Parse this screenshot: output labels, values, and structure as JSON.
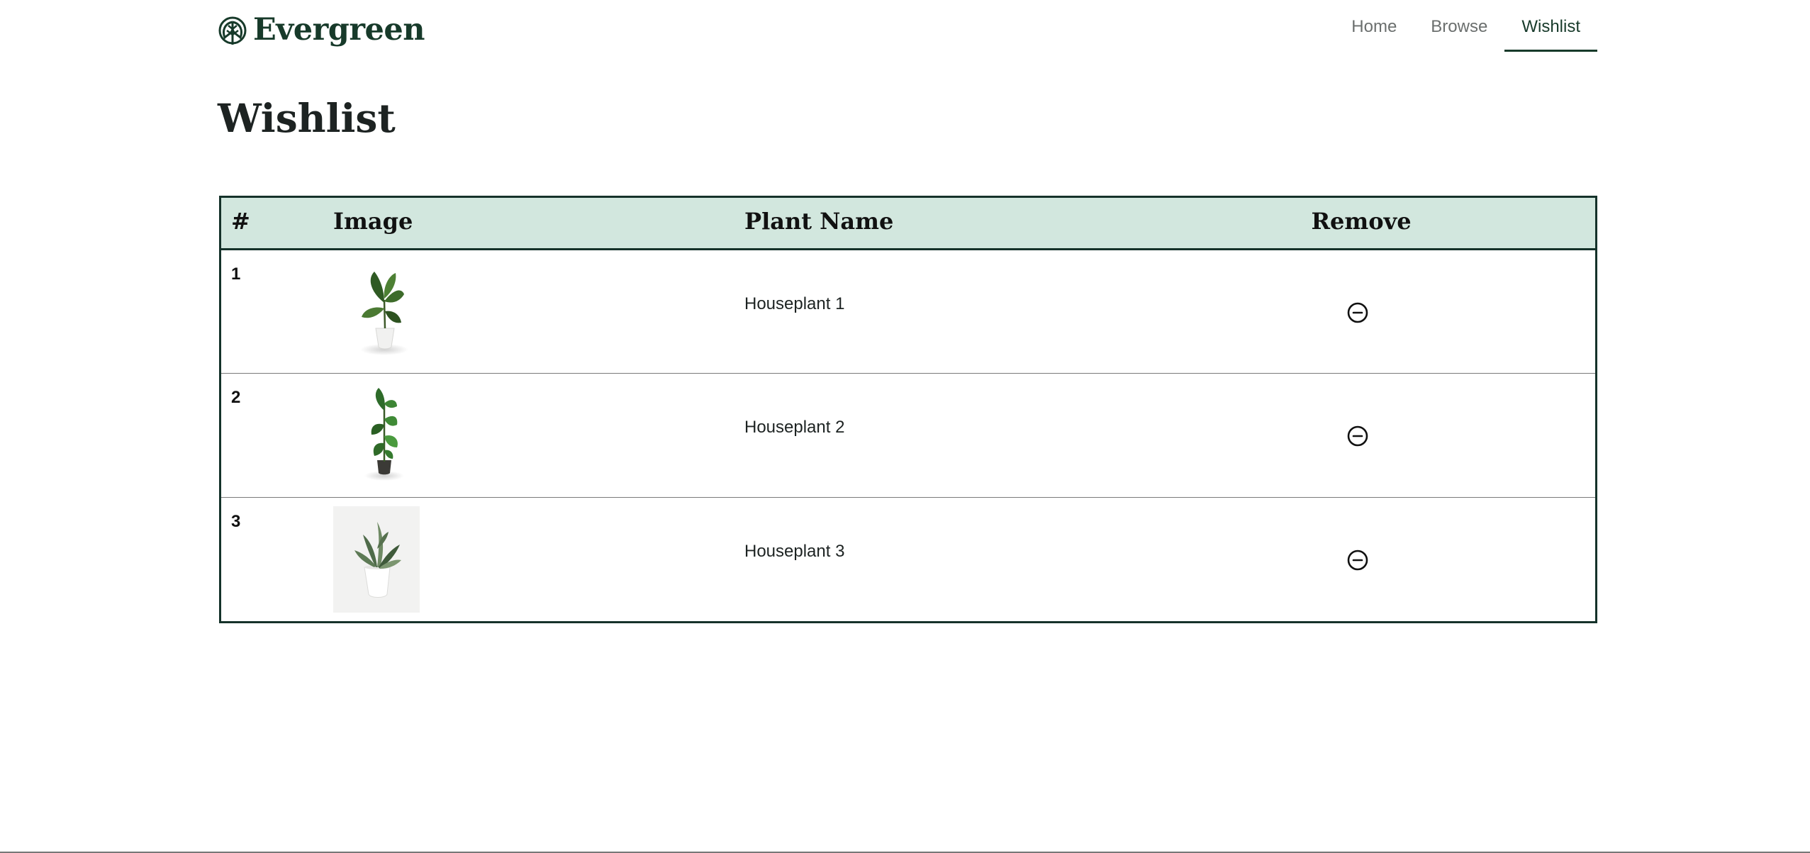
{
  "brand": {
    "name": "Evergreen",
    "icon": "leaf-logo-icon",
    "color": "#173a2a"
  },
  "nav": {
    "items": [
      {
        "label": "Home",
        "active": false
      },
      {
        "label": "Browse",
        "active": false
      },
      {
        "label": "Wishlist",
        "active": true
      }
    ]
  },
  "page": {
    "title": "Wishlist"
  },
  "table": {
    "header_bg": "#d2e7de",
    "columns": [
      "#",
      "Image",
      "Plant Name",
      "Remove"
    ],
    "rows": [
      {
        "num": "1",
        "image": "plant-photo-1",
        "name": "Houseplant 1",
        "remove_icon": "minus-circle-icon"
      },
      {
        "num": "2",
        "image": "plant-photo-2",
        "name": "Houseplant 2",
        "remove_icon": "minus-circle-icon"
      },
      {
        "num": "3",
        "image": "plant-photo-3",
        "name": "Houseplant 3",
        "remove_icon": "minus-circle-icon"
      }
    ]
  }
}
